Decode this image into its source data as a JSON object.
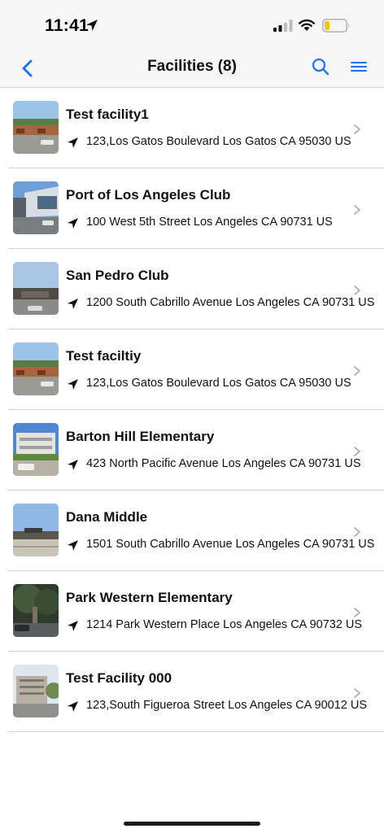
{
  "status_bar": {
    "time": "11:41",
    "icons": [
      "location-arrow-icon",
      "cellular-signal-icon",
      "wifi-icon",
      "battery-low-icon"
    ]
  },
  "nav": {
    "title": "Facilities (8)",
    "back_icon": "chevron-left-icon",
    "search_icon": "search-icon",
    "menu_icon": "menu-icon",
    "accent_color": "#1a73e8"
  },
  "facilities": [
    {
      "name": "Test facility1",
      "address": "123,Los Gatos Boulevard Los Gatos CA 95030 US"
    },
    {
      "name": "Port of Los Angeles Club",
      "address": "100 West 5th Street Los Angeles CA 90731 US"
    },
    {
      "name": "San Pedro Club",
      "address": "1200 South Cabrillo Avenue Los Angeles CA 90731 US"
    },
    {
      "name": "Test faciltiy",
      "address": "123,Los Gatos Boulevard Los Gatos CA 95030 US"
    },
    {
      "name": "Barton Hill Elementary",
      "address": "423 North Pacific Avenue Los Angeles CA 90731 US"
    },
    {
      "name": "Dana Middle",
      "address": "1501 South Cabrillo Avenue Los Angeles CA 90731 US"
    },
    {
      "name": "Park Western Elementary",
      "address": "1214 Park Western Place Los Angeles CA 90732 US"
    },
    {
      "name": "Test Facility 000",
      "address": "123,South Figueroa Street Los Angeles CA 90012 US"
    }
  ]
}
